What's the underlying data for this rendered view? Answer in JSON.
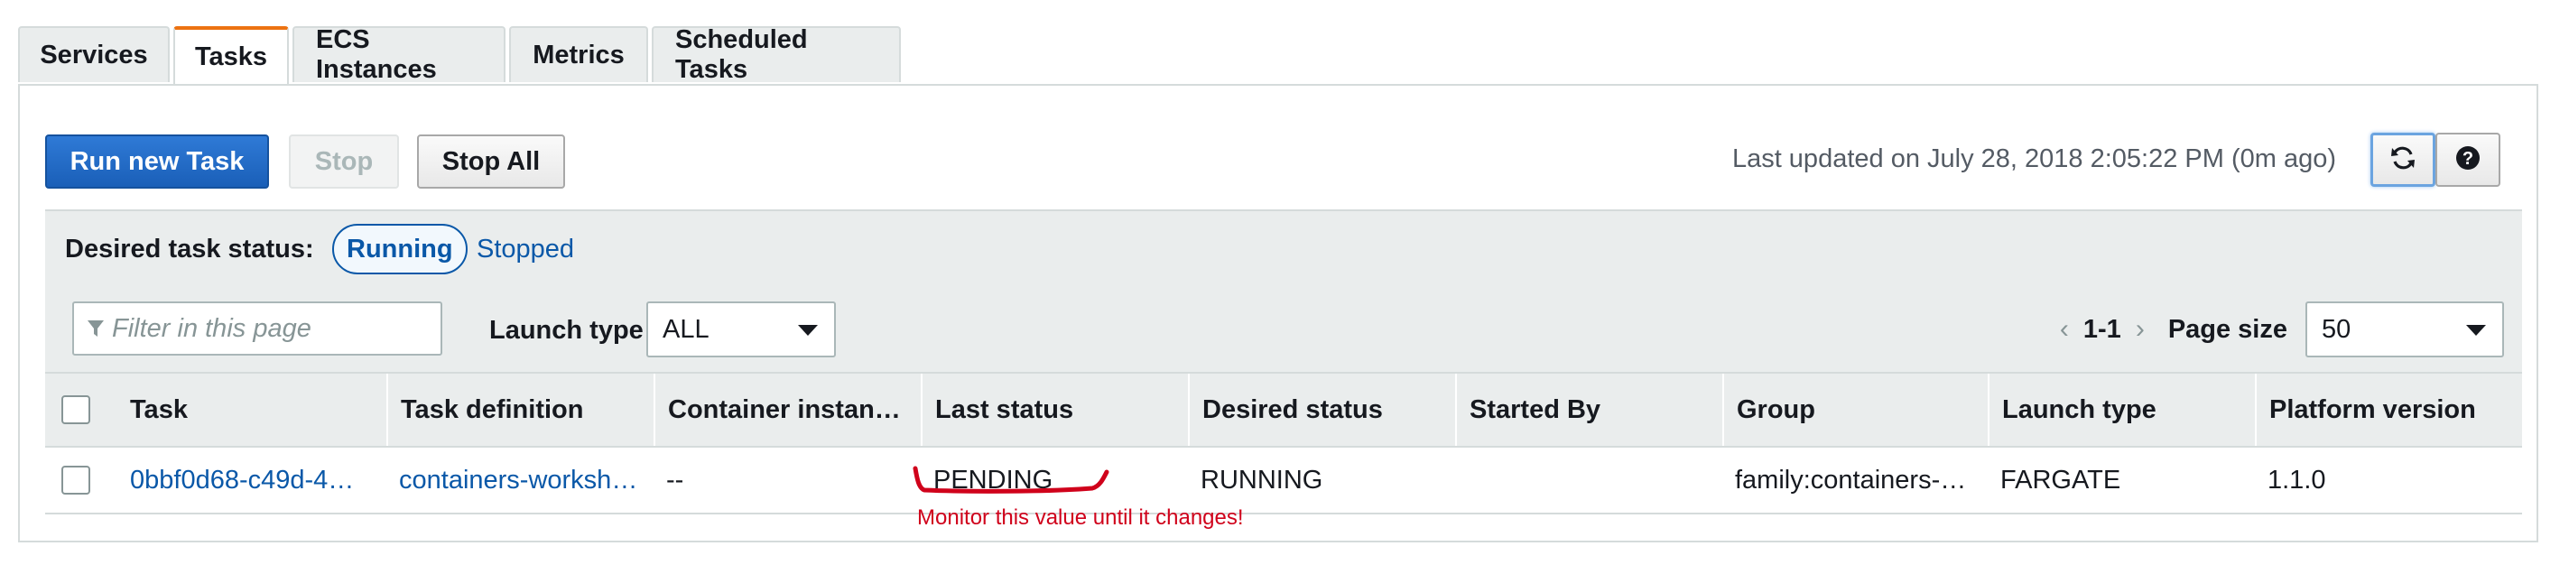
{
  "tabs": [
    {
      "label": "Services"
    },
    {
      "label": "Tasks"
    },
    {
      "label": "ECS Instances"
    },
    {
      "label": "Metrics"
    },
    {
      "label": "Scheduled Tasks"
    }
  ],
  "toolbar": {
    "run_label": "Run new Task",
    "stop_label": "Stop",
    "stop_all_label": "Stop All",
    "last_updated": "Last updated on July 28, 2018 2:05:22 PM (0m ago)"
  },
  "status": {
    "label": "Desired task status:",
    "running": "Running",
    "stopped": "Stopped"
  },
  "filter": {
    "placeholder": "Filter in this page",
    "launch_type_label": "Launch type",
    "launch_type_value": "ALL",
    "range": "1-1",
    "page_size_label": "Page size",
    "page_size_value": "50"
  },
  "table": {
    "columns": [
      "Task",
      "Task definition",
      "Container instan…",
      "Last status",
      "Desired status",
      "Started By",
      "Group",
      "Launch type",
      "Platform version"
    ],
    "rows": [
      {
        "task": "0bbf0d68-c49d-4…",
        "task_definition": "containers-worksh…",
        "container_instance": "--",
        "last_status": "PENDING",
        "desired_status": "RUNNING",
        "started_by": "",
        "group": "family:containers-…",
        "launch_type": "FARGATE",
        "platform_version": "1.1.0"
      }
    ]
  },
  "annotation": {
    "text": "Monitor this value until it changes!",
    "color": "#d0021b"
  },
  "colors": {
    "accent_tab": "#ec7211",
    "primary": "#1a5fb8",
    "link": "#0a58a8"
  }
}
